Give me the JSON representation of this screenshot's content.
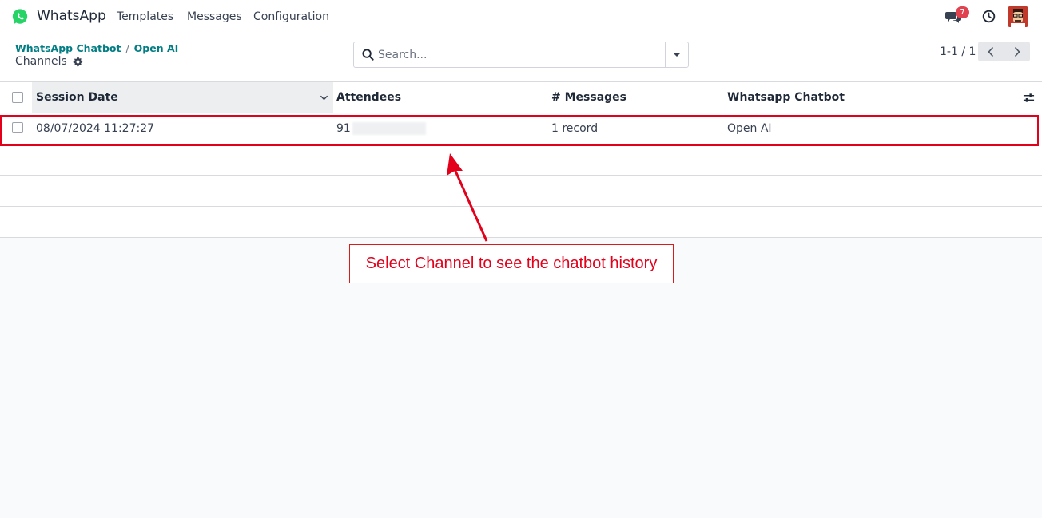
{
  "navbar": {
    "app_name": "WhatsApp",
    "menu": [
      {
        "label": "Templates"
      },
      {
        "label": "Messages"
      },
      {
        "label": "Configuration"
      }
    ],
    "chat_badge_count": "7",
    "brand_color": "#25d366",
    "badge_color": "#e1424f",
    "icons": [
      "whatsapp-logo-icon",
      "chat-bubbles-icon",
      "clock-icon",
      "avatar"
    ]
  },
  "control_panel": {
    "breadcrumb": [
      {
        "label": "WhatsApp Chatbot"
      },
      {
        "label": "Open AI"
      }
    ],
    "breadcrumb_separator": "/",
    "page_title": "Channels",
    "search_placeholder": "Search...",
    "pager": "1-1 / 1"
  },
  "list": {
    "columns": [
      "Session Date",
      "Attendees",
      "# Messages",
      "Whatsapp Chatbot"
    ],
    "sorted_column": "Session Date",
    "rows": [
      {
        "session_date": "08/07/2024 11:27:27",
        "attendees": "91",
        "messages": "1 record",
        "chatbot": "Open AI"
      }
    ]
  },
  "annotation": {
    "text": "Select Channel to see the chatbot history",
    "color": "#e3001b"
  }
}
